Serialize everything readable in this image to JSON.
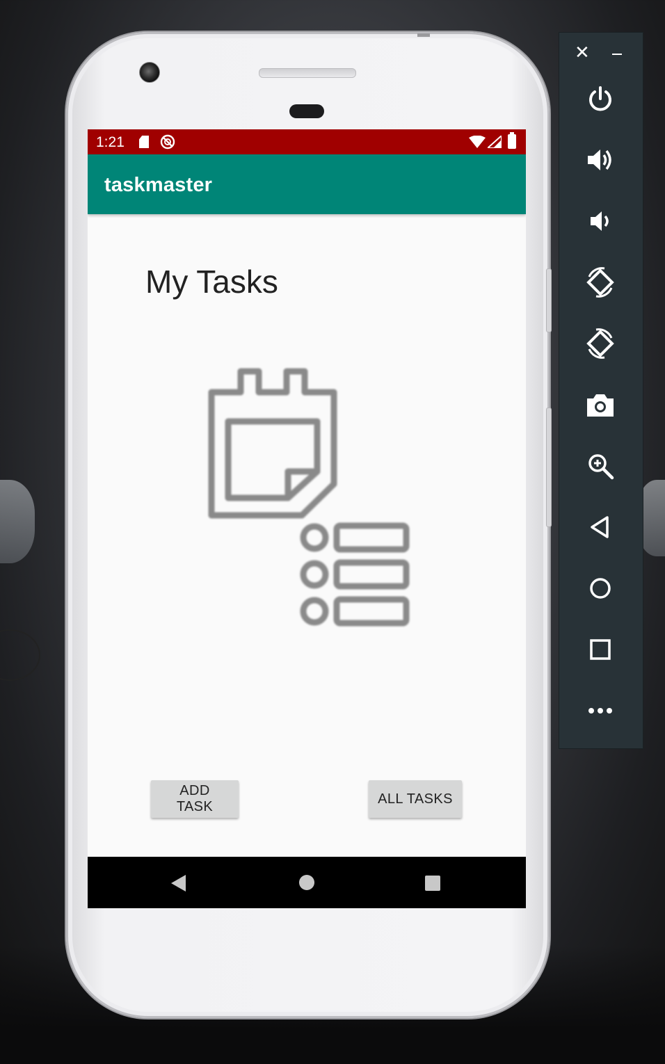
{
  "status_bar": {
    "time": "1:21",
    "color": "#a00000"
  },
  "app_bar": {
    "title": "taskmaster",
    "color": "#008577"
  },
  "main": {
    "heading": "My Tasks",
    "hero_icon": "calendar-task-list-icon"
  },
  "buttons": {
    "add_task": "ADD TASK",
    "all_tasks": "ALL TASKS"
  },
  "nav_bar": {
    "items": [
      "back-icon",
      "home-icon",
      "recents-icon"
    ]
  },
  "emulator_panel": {
    "items": [
      "close-icon",
      "minimize-icon",
      "power-icon",
      "volume-up-icon",
      "volume-down-icon",
      "rotate-left-icon",
      "rotate-right-icon",
      "camera-icon",
      "zoom-icon",
      "back-icon",
      "home-icon",
      "overview-icon",
      "more-icon"
    ]
  }
}
